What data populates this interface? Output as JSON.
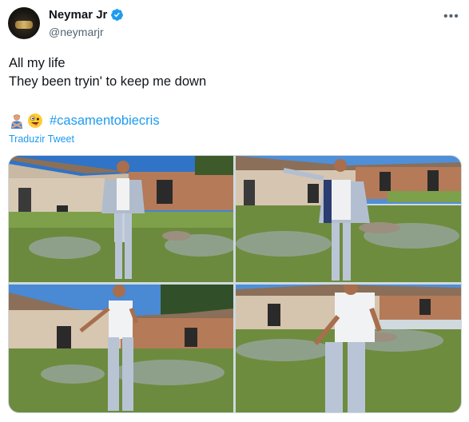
{
  "author": {
    "name": "Neymar Jr",
    "handle": "@neymarjr",
    "verified": true
  },
  "more_icon": "more-horizontal-icon",
  "tweet": {
    "line1": "All my life",
    "line2": "They been tryin' to keep me down",
    "emojis": [
      "man-gesturing-no-icon",
      "zany-face-icon"
    ],
    "hashtag": "#casamentobiecris",
    "translate_label": "Traduzir Tweet"
  },
  "media": {
    "count": 4
  },
  "colors": {
    "accent": "#1d9bf0",
    "text": "#0f1419",
    "secondary": "#536471"
  }
}
